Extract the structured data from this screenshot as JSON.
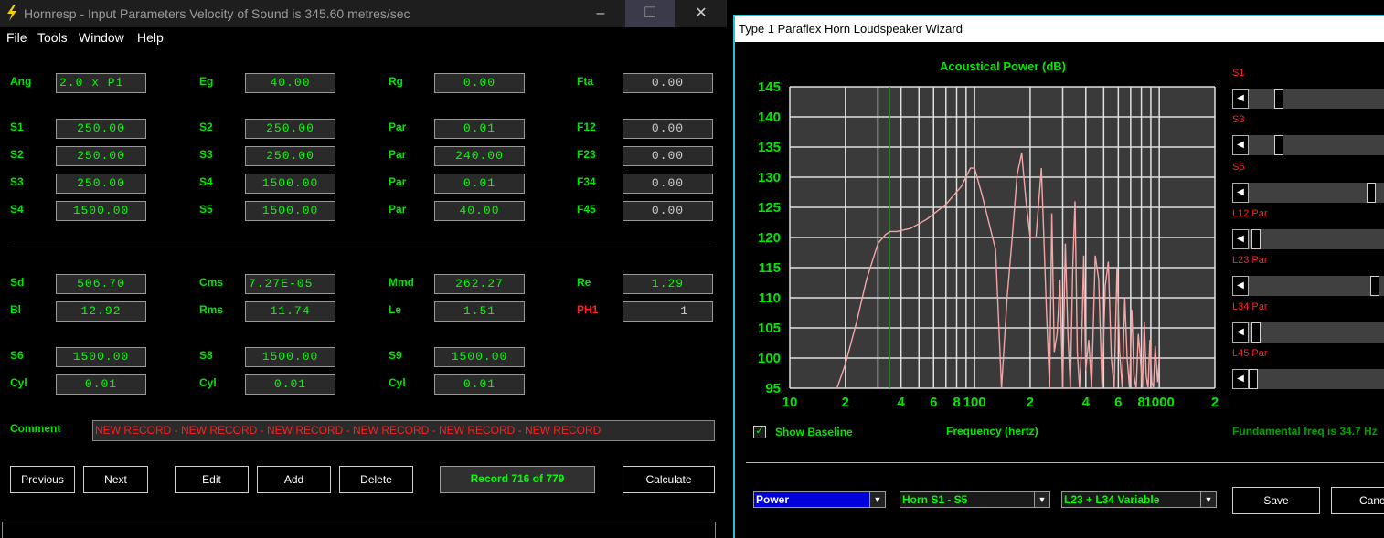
{
  "window1": {
    "title": "Hornresp - Input Parameters    Velocity of Sound is 345.60 metres/sec",
    "controls": {
      "minimize": "–",
      "maximize": "☐",
      "close": "✕"
    },
    "menu": [
      "File",
      "Tools",
      "Window",
      "Help"
    ],
    "rows1": [
      {
        "label": "Ang",
        "value": "2.0 x Pi"
      },
      {
        "label": "Eg",
        "value": "40.00"
      },
      {
        "label": "Rg",
        "value": "0.00"
      },
      {
        "label": "Fta",
        "value": "0.00"
      }
    ],
    "grid1": [
      [
        {
          "label": "S1",
          "value": "250.00"
        },
        {
          "label": "S2",
          "value": "250.00"
        },
        {
          "label": "Par",
          "value": "0.01"
        },
        {
          "label": "F12",
          "value": "0.00"
        }
      ],
      [
        {
          "label": "S2",
          "value": "250.00"
        },
        {
          "label": "S3",
          "value": "250.00"
        },
        {
          "label": "Par",
          "value": "240.00"
        },
        {
          "label": "F23",
          "value": "0.00"
        }
      ],
      [
        {
          "label": "S3",
          "value": "250.00"
        },
        {
          "label": "S4",
          "value": "1500.00"
        },
        {
          "label": "Par",
          "value": "0.01"
        },
        {
          "label": "F34",
          "value": "0.00"
        }
      ],
      [
        {
          "label": "S4",
          "value": "1500.00"
        },
        {
          "label": "S5",
          "value": "1500.00"
        },
        {
          "label": "Par",
          "value": "40.00"
        },
        {
          "label": "F45",
          "value": "0.00"
        }
      ]
    ],
    "grid2": [
      [
        {
          "label": "Sd",
          "value": "506.70"
        },
        {
          "label": "Cms",
          "value": "7.27E-05"
        },
        {
          "label": "Mmd",
          "value": "262.27"
        },
        {
          "label": "Re",
          "value": "1.29"
        }
      ],
      [
        {
          "label": "Bl",
          "value": "12.92"
        },
        {
          "label": "Rms",
          "value": "11.74"
        },
        {
          "label": "Le",
          "value": "1.51"
        },
        {
          "label": "PH1",
          "value": "1"
        }
      ]
    ],
    "grid3": [
      [
        {
          "label": "S6",
          "value": "1500.00"
        },
        {
          "label": "S8",
          "value": "1500.00"
        },
        {
          "label": "S9",
          "value": "1500.00"
        }
      ],
      [
        {
          "label": "Cyl",
          "value": "0.01"
        },
        {
          "label": "Cyl",
          "value": "0.01"
        },
        {
          "label": "Cyl",
          "value": "0.01"
        }
      ]
    ],
    "comment_label": "Comment",
    "comment_value": "NEW RECORD - NEW RECORD - NEW RECORD - NEW RECORD - NEW RECORD - NEW RECORD",
    "buttons": {
      "previous": "Previous",
      "next": "Next",
      "edit": "Edit",
      "add": "Add",
      "delete": "Delete",
      "calculate": "Calculate"
    },
    "record_status": "Record 716 of 779"
  },
  "window2": {
    "title": "Type 1 Paraflex Horn Loudspeaker Wizard",
    "sliders": [
      {
        "label": "S1",
        "level": 0.2
      },
      {
        "label": "S3",
        "level": 0.2
      },
      {
        "label": "S5",
        "level": 0.92
      },
      {
        "label": "L12 Par",
        "level": 0.02
      },
      {
        "label": "L23 Par",
        "level": 0.95
      },
      {
        "label": "L34 Par",
        "level": 0.02
      },
      {
        "label": "L45 Par",
        "level": 0.0
      }
    ],
    "show_baseline_label": "Show Baseline",
    "show_baseline_checked": true,
    "fundamental": "Fundamental freq is 34.7 Hz",
    "dropdowns": [
      "Power",
      "Horn S1 - S5",
      "L23 + L34 Variable"
    ],
    "save_label": "Save",
    "cancel_label": "Cancel"
  },
  "chart_data": {
    "type": "line",
    "title": "Acoustical Power (dB)",
    "xlabel": "Frequency (hertz)",
    "ylabel": "",
    "x_scale": "log",
    "xlim": [
      10,
      2000
    ],
    "ylim": [
      95,
      145
    ],
    "yticks": [
      "145",
      "140",
      "135",
      "130",
      "125",
      "120",
      "115",
      "110",
      "105",
      "100",
      "95"
    ],
    "xticks": [
      "10",
      "2",
      "4",
      "6",
      "8",
      "100",
      "2",
      "4",
      "6",
      "8",
      "1000",
      "2"
    ],
    "xtick_values": [
      10,
      20,
      40,
      60,
      80,
      100,
      200,
      400,
      600,
      800,
      1000,
      2000
    ],
    "baseline_freq": 34.7,
    "series": [
      {
        "x": [
          18,
          20,
          23,
          26,
          30,
          33,
          35,
          38,
          45,
          55,
          70,
          85,
          95,
          100,
          110,
          130,
          140,
          150,
          160,
          170,
          180,
          190,
          200,
          215,
          230,
          245,
          255,
          262,
          270,
          280,
          290,
          300,
          310,
          320,
          330,
          340,
          350,
          360,
          370,
          380,
          390,
          400,
          415,
          430,
          450,
          470,
          490,
          510,
          530,
          550,
          570,
          590,
          610,
          630,
          650,
          670,
          690,
          710,
          730,
          750,
          770,
          790,
          810,
          830,
          850,
          870,
          890,
          910,
          930,
          950,
          980,
          1000
        ],
        "y": [
          95,
          99,
          106,
          113,
          119,
          120.5,
          121,
          121,
          121.5,
          123,
          125.5,
          128.5,
          131.5,
          131.5,
          127,
          118,
          95,
          110,
          120,
          130.5,
          134,
          126,
          120,
          120,
          131.5,
          108,
          95,
          124,
          101,
          104,
          113,
          95,
          119,
          104,
          95,
          115,
          126,
          101,
          95,
          102,
          117,
          98,
          103,
          94,
          117,
          113,
          95,
          112,
          116,
          100,
          95,
          115,
          101,
          95,
          110,
          100,
          95,
          108,
          97,
          95,
          104,
          100,
          94,
          106,
          97,
          95,
          103,
          96,
          95,
          102,
          96,
          100
        ]
      }
    ]
  }
}
